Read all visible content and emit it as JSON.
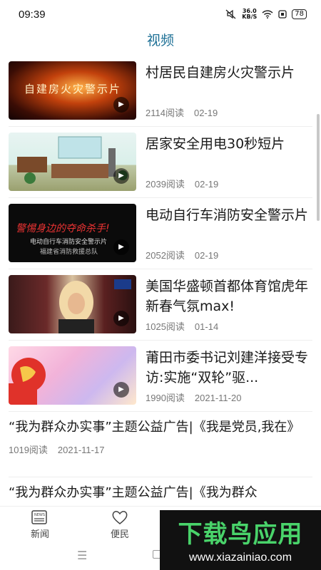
{
  "status_bar": {
    "time": "09:39",
    "net_speed_value": "36.0",
    "net_speed_unit": "KB/S",
    "battery": "78"
  },
  "header": {
    "title": "视频"
  },
  "video_items": [
    {
      "title": "村居民自建房火灾警示片",
      "reads": "2114阅读",
      "date": "02-19",
      "thumb_caption": "自建房火灾警示片"
    },
    {
      "title": "居家安全用电30秒短片",
      "reads": "2039阅读",
      "date": "02-19",
      "thumb_caption": ""
    },
    {
      "title": "电动自行车消防安全警示片",
      "reads": "2052阅读",
      "date": "02-19",
      "thumb_caption": "警惕身边的夺命杀手!",
      "thumb_caption2": "电动自行车消防安全警示片",
      "thumb_caption3": "福建省消防救援总队"
    },
    {
      "title": "美国华盛顿首都体育馆虎年新春气氛max!",
      "reads": "1025阅读",
      "date": "01-14",
      "thumb_caption": ""
    },
    {
      "title": "莆田市委书记刘建洋接受专访:实施“双轮”驱...",
      "reads": "1990阅读",
      "date": "2021-11-20",
      "thumb_caption": ""
    }
  ],
  "text_items": [
    {
      "title": "“我为群众办实事”主题公益广告|《我是党员,我在》",
      "reads": "1019阅读",
      "date": "2021-11-17"
    },
    {
      "title": "“我为群众办实事”主题公益广告|《我为群众",
      "reads": "",
      "date": ""
    }
  ],
  "tab_bar": {
    "tabs": [
      {
        "label": "新闻",
        "icon": "newspaper-icon"
      },
      {
        "label": "便民",
        "icon": "heart-icon"
      }
    ]
  },
  "watermark": {
    "main": "下载鸟应用",
    "url": "www.xiazainiao.com"
  },
  "colors": {
    "title_blue": "#1c6f95",
    "meta_gray": "#777777",
    "watermark_green": "#49d36a"
  }
}
